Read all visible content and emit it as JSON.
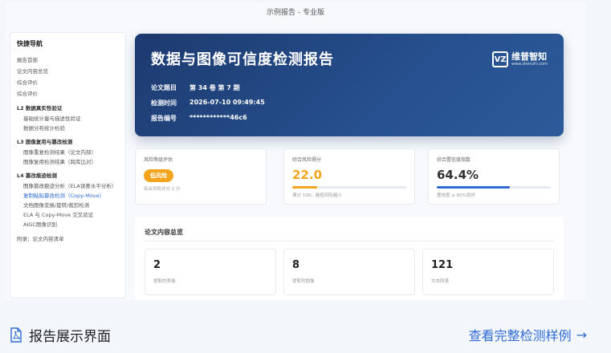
{
  "frame_title": "示例报告 - 专业版",
  "sidebar": {
    "title": "快捷导航",
    "items": [
      "报告首部",
      "论文内容总览",
      "综合评价",
      "综合评价"
    ],
    "sections": [
      {
        "title": "L2 数据真实性验证",
        "items": [
          "基础统计量与描述性验证",
          "数据分布统计检验"
        ]
      },
      {
        "title": "L3 图像复用与篡改检测",
        "items": [
          "图像重复检测结果（论文内部）",
          "图像复用检测结果（跨库比对）"
        ]
      },
      {
        "title": "L4 篡改痕迹检测",
        "items": [
          "图像篡改痕迹分析（ELA误差水平分析）",
          "复制粘贴篡改检测（Copy-Move）",
          "文档图像变换/旋转/裁剪检测",
          "ELA 与 Copy-Move 交叉验证",
          "AIGC图像识别"
        ]
      }
    ],
    "footer": "附录：论文内容清单"
  },
  "hero": {
    "title": "数据与图像可信度检测报告",
    "logo_mark": "VZ",
    "logo_name": "维普智知",
    "logo_url": "www.zhenzhi.com",
    "rows": [
      {
        "key": "论文题目",
        "value": "第 34 卷 第 7 期"
      },
      {
        "key": "检测时间",
        "value": "2026-07-10 09:49:45"
      },
      {
        "key": "报告编号",
        "value": "************46c6"
      }
    ]
  },
  "cards": [
    {
      "label": "风险等级评估",
      "pill": "低风险",
      "sub": "综合风险评分 2 分"
    },
    {
      "label": "综合风险得分",
      "value": "22.0",
      "bar_fraction": 0.22,
      "bar_color": "#f3a41d",
      "value_color": "#f3a41d",
      "sub": "满分 100，越低风险越小"
    },
    {
      "label": "综合置信度指数",
      "value": "64.4%",
      "bar_fraction": 0.644,
      "bar_color": "#2f6bd1",
      "value_color": "#333333",
      "sub": "置信度 ≥ 60%良好"
    }
  ],
  "overview": {
    "title": "论文内容总览",
    "stats": [
      {
        "num": "2",
        "cap": "提取的表格"
      },
      {
        "num": "8",
        "cap": "提取的图像"
      },
      {
        "num": "121",
        "cap": "文本段落"
      }
    ]
  },
  "bottom": {
    "label": "报告展示界面",
    "link": "查看完整检测样例",
    "arrow": "→"
  }
}
